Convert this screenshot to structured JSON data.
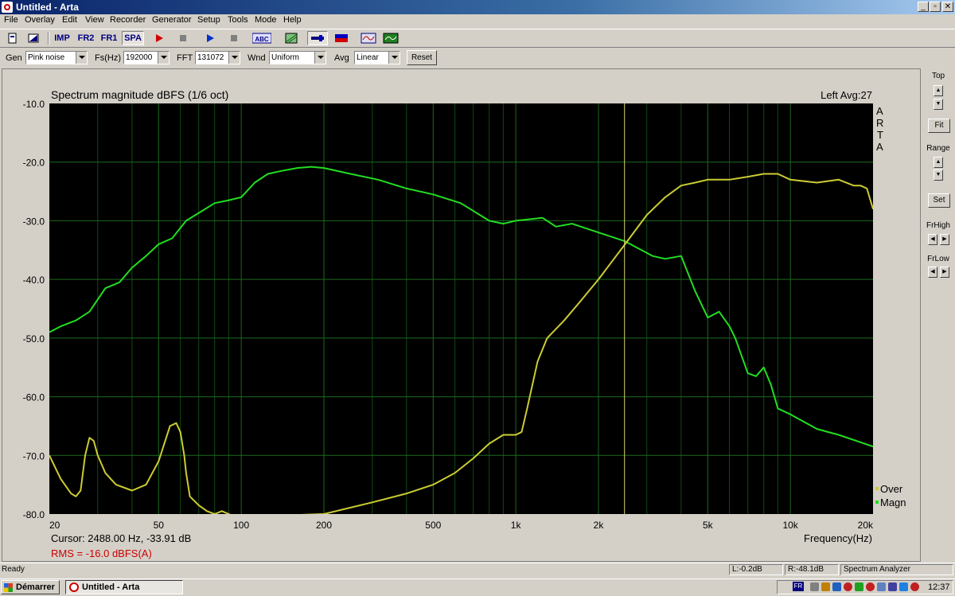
{
  "window": {
    "title": "Untitled - Arta",
    "minimize": "_",
    "restore": "▫",
    "close": "✕"
  },
  "menu": [
    "File",
    "Overlay",
    "Edit",
    "View",
    "Recorder",
    "Generator",
    "Setup",
    "Tools",
    "Mode",
    "Help"
  ],
  "toolbar": {
    "imp": "IMP",
    "fr2": "FR2",
    "fr1": "FR1",
    "spa": "SPA",
    "abc": "ABC"
  },
  "controls": {
    "gen_label": "Gen",
    "gen_value": "Pink noise",
    "fs_label": "Fs(Hz)",
    "fs_value": "192000",
    "fft_label": "FFT",
    "fft_value": "131072",
    "wnd_label": "Wnd",
    "wnd_value": "Uniform",
    "avg_label": "Avg",
    "avg_value": "Linear",
    "reset_label": "Reset"
  },
  "plot": {
    "title": "Spectrum magnitude dBFS (1/6 oct)",
    "channel_info": "Left  Avg:27",
    "side_label": [
      "A",
      "R",
      "T",
      "A"
    ],
    "cursor_text": "Cursor:  2488.00 Hz, -33.91 dB",
    "rms_text": "RMS =  -16.0 dBFS(A)",
    "x_axis_label": "Frequency(Hz)",
    "legend": [
      "Over",
      "Magn"
    ]
  },
  "chart_data": {
    "type": "line",
    "title": "Spectrum magnitude dBFS (1/6 oct)",
    "xlabel": "Frequency(Hz)",
    "ylabel": "",
    "x_scale": "log",
    "xlim": [
      20,
      20000
    ],
    "ylim": [
      -80,
      -10
    ],
    "x_ticks": [
      20,
      50,
      100,
      200,
      500,
      1000,
      2000,
      5000,
      10000,
      20000
    ],
    "x_tick_labels": [
      "20",
      "50",
      "100",
      "200",
      "500",
      "1k",
      "2k",
      "5k",
      "10k",
      "20k"
    ],
    "y_ticks": [
      -10,
      -20,
      -30,
      -40,
      -50,
      -60,
      -70,
      -80
    ],
    "y_tick_labels": [
      "-10.0",
      "-20.0",
      "-30.0",
      "-40.0",
      "-50.0",
      "-60.0",
      "-70.0",
      "-80.0"
    ],
    "grid": true,
    "cursor_x": 2488,
    "series": [
      {
        "name": "Magn",
        "color": "#22dd22",
        "x": [
          20,
          22,
          25,
          28,
          32,
          36,
          40,
          45,
          50,
          56,
          63,
          71,
          80,
          90,
          100,
          112,
          125,
          140,
          160,
          180,
          200,
          250,
          315,
          400,
          500,
          630,
          800,
          900,
          1000,
          1250,
          1400,
          1600,
          2000,
          2500,
          3150,
          3500,
          4000,
          4500,
          5000,
          5500,
          6000,
          6300,
          7000,
          7500,
          8000,
          8500,
          9000,
          10000,
          12500,
          15000,
          20000
        ],
        "y": [
          -49,
          -48,
          -47,
          -45.5,
          -41.5,
          -40.5,
          -38,
          -36,
          -34,
          -33,
          -30,
          -28.5,
          -27,
          -26.5,
          -26,
          -23.5,
          -22,
          -21.5,
          -21,
          -20.8,
          -21,
          -22,
          -23,
          -24.5,
          -25.5,
          -27,
          -30,
          -30.5,
          -30,
          -29.5,
          -31,
          -30.5,
          -32,
          -33.5,
          -36,
          -36.5,
          -36,
          -42,
          -46.5,
          -45.5,
          -48,
          -50,
          -56,
          -56.5,
          -55,
          -58,
          -62,
          -63,
          -65.5,
          -66.5,
          -68.5
        ]
      },
      {
        "name": "Over",
        "color": "#cccc33",
        "x": [
          20,
          22,
          24,
          25,
          26,
          27,
          28,
          29,
          30,
          32,
          35,
          40,
          45,
          50,
          55,
          58,
          60,
          62,
          63,
          65,
          70,
          75,
          80,
          85,
          90,
          95,
          200,
          300,
          400,
          500,
          600,
          700,
          800,
          900,
          1000,
          1050,
          1100,
          1200,
          1300,
          1500,
          1700,
          2000,
          2500,
          3000,
          3500,
          4000,
          4500,
          5000,
          6000,
          7000,
          8000,
          9000,
          10000,
          12500,
          15000,
          17000,
          18000,
          19000,
          20000
        ],
        "y": [
          -70,
          -74,
          -76.5,
          -77,
          -76,
          -70,
          -67,
          -67.5,
          -70,
          -73,
          -75,
          -76,
          -75,
          -71,
          -65,
          -64.5,
          -66,
          -70,
          -73,
          -77,
          -78.5,
          -79.5,
          -80,
          -79.5,
          -80,
          -80.5,
          -80,
          -78,
          -76.5,
          -75,
          -73,
          -70.5,
          -68,
          -66.5,
          -66.5,
          -66,
          -62,
          -54,
          -50,
          -47,
          -44,
          -40,
          -34,
          -29,
          -26,
          -24,
          -23.5,
          -23,
          -23,
          -22.5,
          -22,
          -22,
          -23,
          -23.5,
          -23,
          -24,
          -24,
          -24.5,
          -28
        ]
      }
    ]
  },
  "right_panel": {
    "top": "Top",
    "fit": "Fit",
    "range": "Range",
    "set": "Set",
    "frhigh": "FrHigh",
    "frlow": "FrLow"
  },
  "status": {
    "ready": "Ready",
    "left": "L:-0.2dB",
    "right": "R:-48.1dB",
    "mode": "Spectrum Analyzer"
  },
  "taskbar": {
    "start": "Démarrer",
    "task": "Untitled - Arta",
    "lang": "FR",
    "clock": "12:37"
  }
}
